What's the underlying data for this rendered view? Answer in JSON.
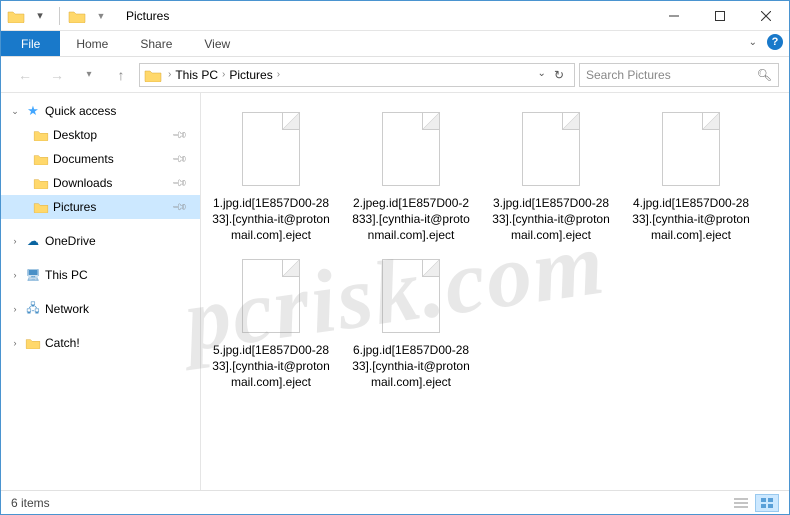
{
  "window": {
    "title": "Pictures"
  },
  "ribbon": {
    "file": "File",
    "tabs": [
      "Home",
      "Share",
      "View"
    ]
  },
  "breadcrumb": {
    "items": [
      "This PC",
      "Pictures"
    ]
  },
  "search": {
    "placeholder": "Search Pictures"
  },
  "sidebar": {
    "quick_access": {
      "label": "Quick access"
    },
    "quick_items": [
      {
        "label": "Desktop"
      },
      {
        "label": "Documents"
      },
      {
        "label": "Downloads"
      },
      {
        "label": "Pictures"
      }
    ],
    "roots": [
      {
        "label": "OneDrive"
      },
      {
        "label": "This PC"
      },
      {
        "label": "Network"
      },
      {
        "label": "Catch!"
      }
    ]
  },
  "files": [
    {
      "name": "1.jpg.id[1E857D00-2833].[cynthia-it@protonmail.com].eject"
    },
    {
      "name": "2.jpeg.id[1E857D00-2833].[cynthia-it@protonmail.com].eject"
    },
    {
      "name": "3.jpg.id[1E857D00-2833].[cynthia-it@protonmail.com].eject"
    },
    {
      "name": "4.jpg.id[1E857D00-2833].[cynthia-it@protonmail.com].eject"
    },
    {
      "name": "5.jpg.id[1E857D00-2833].[cynthia-it@protonmail.com].eject"
    },
    {
      "name": "6.jpg.id[1E857D00-2833].[cynthia-it@protonmail.com].eject"
    }
  ],
  "statusbar": {
    "count": "6 items"
  },
  "watermark": "pcrisk.com"
}
